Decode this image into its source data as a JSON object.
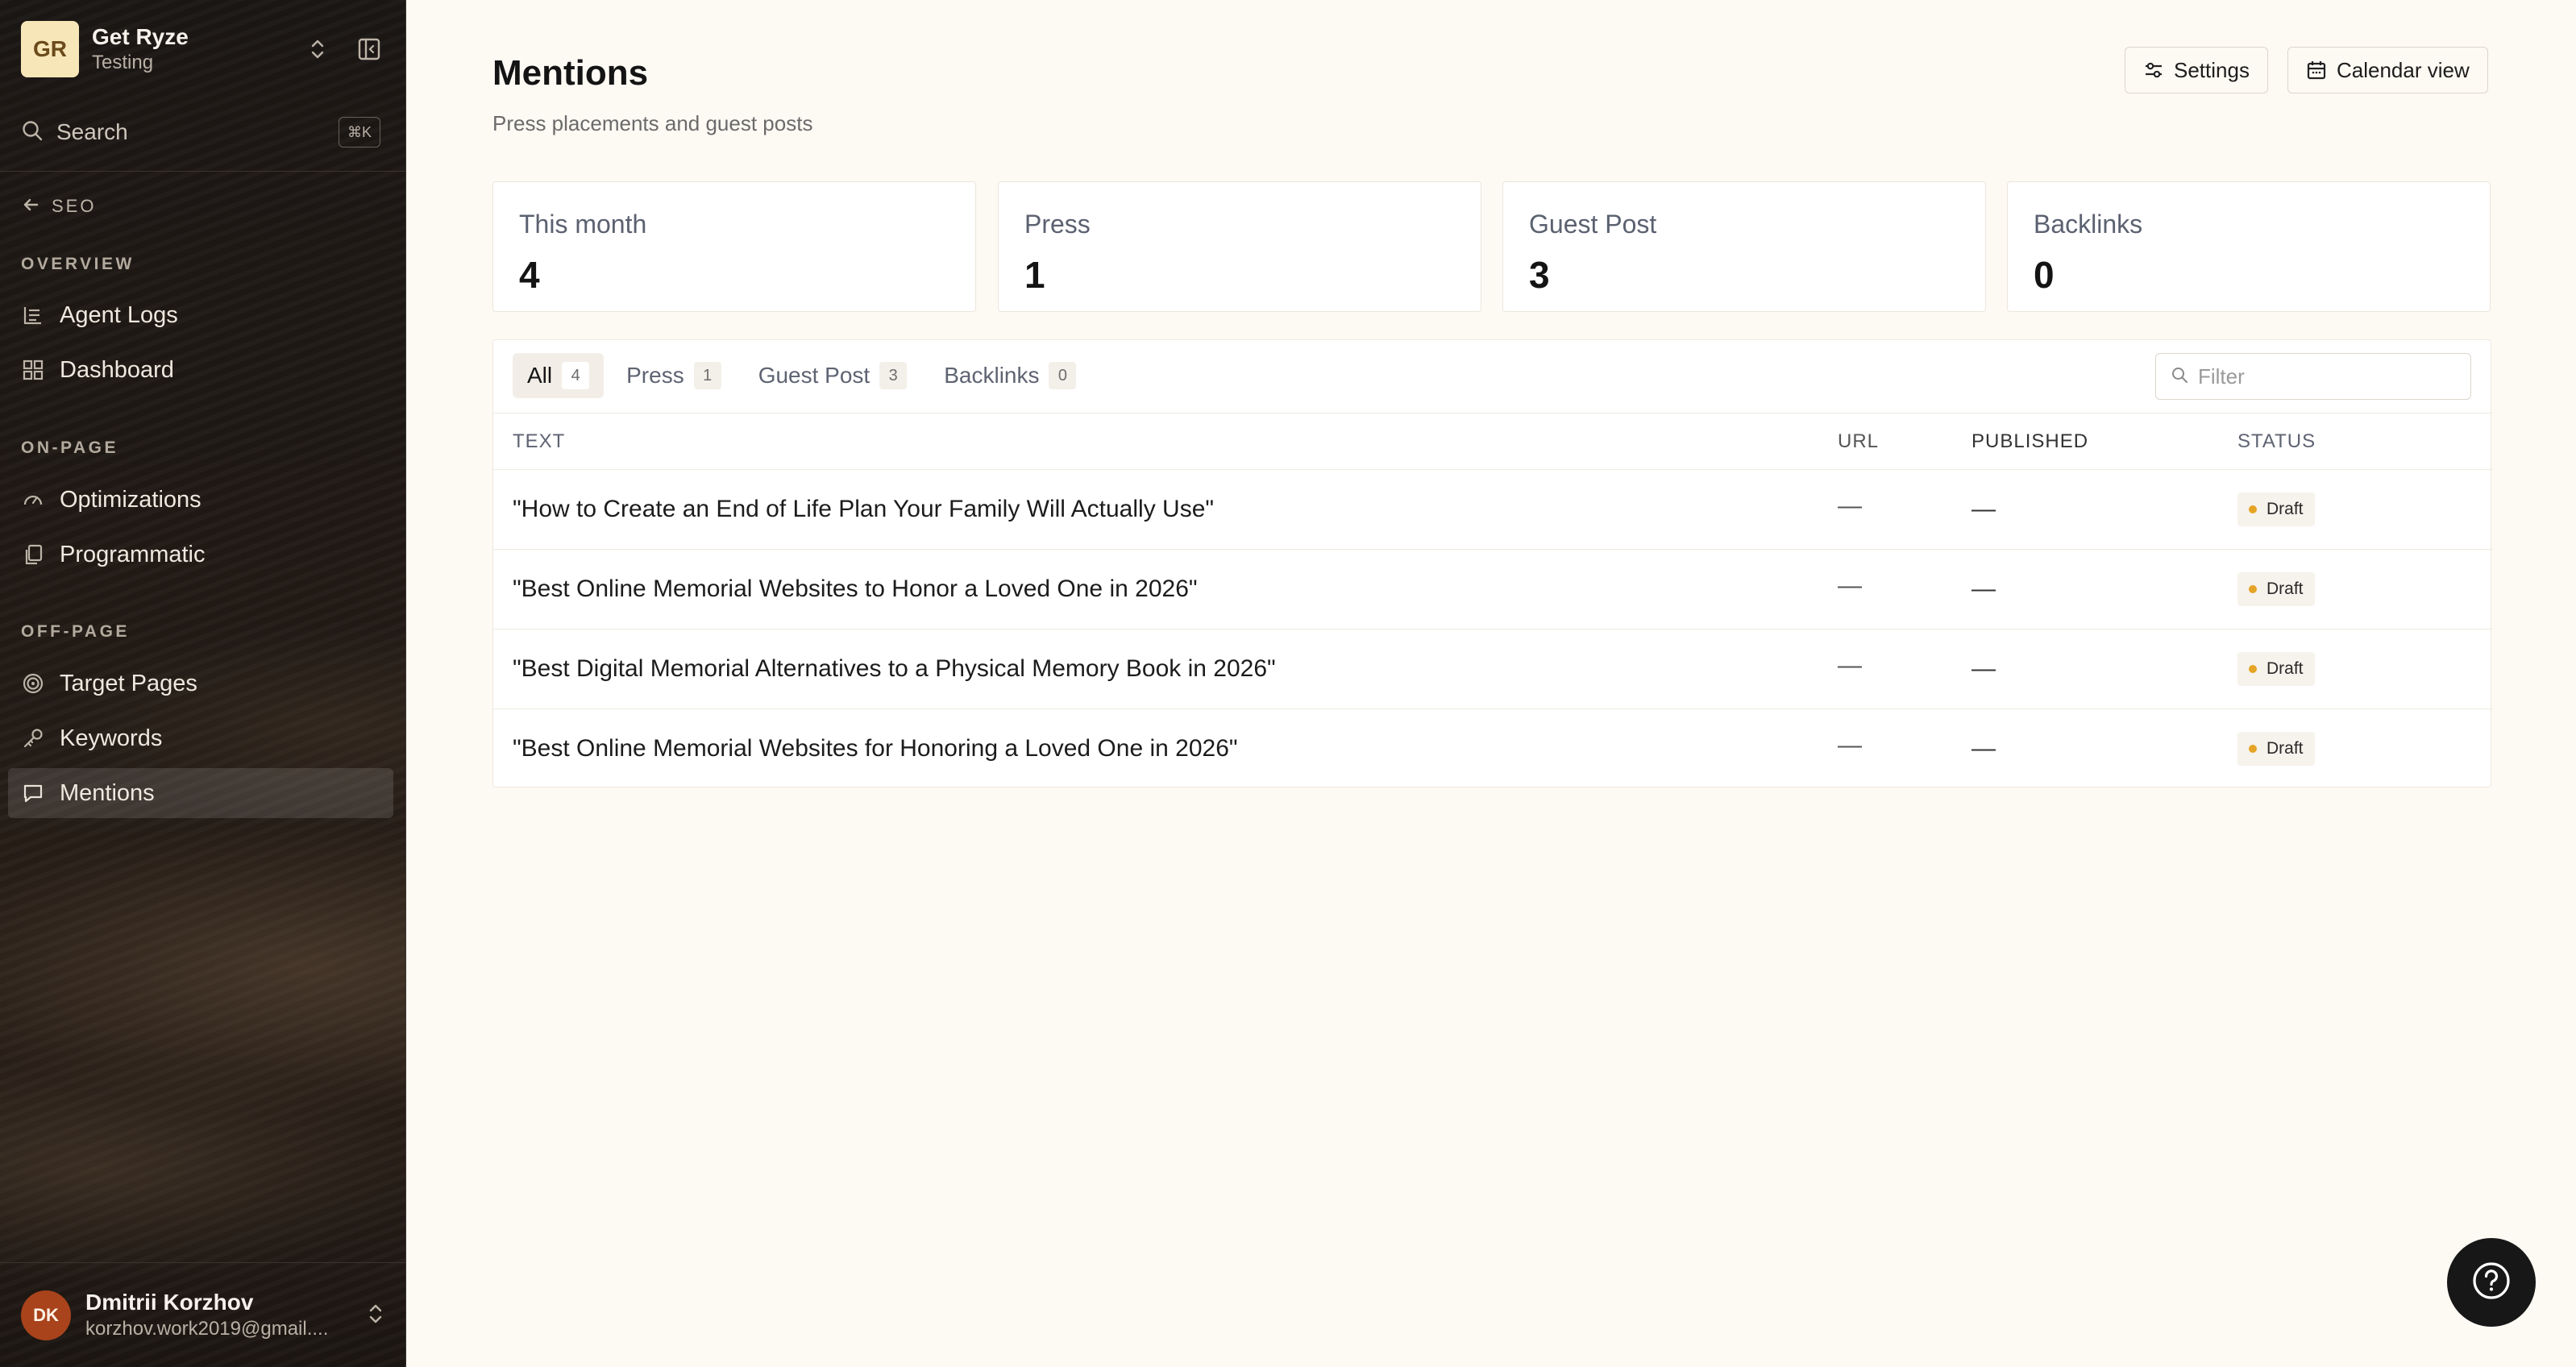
{
  "workspace": {
    "initials": "GR",
    "name": "Get Ryze",
    "subtitle": "Testing"
  },
  "search": {
    "label": "Search",
    "shortcut": "⌘K"
  },
  "nav": {
    "back_label": "SEO",
    "sections": [
      {
        "title": "OVERVIEW",
        "items": [
          {
            "label": "Agent Logs",
            "icon": "list-icon"
          },
          {
            "label": "Dashboard",
            "icon": "grid-icon"
          }
        ]
      },
      {
        "title": "ON-PAGE",
        "items": [
          {
            "label": "Optimizations",
            "icon": "gauge-icon"
          },
          {
            "label": "Programmatic",
            "icon": "copy-icon"
          }
        ]
      },
      {
        "title": "OFF-PAGE",
        "items": [
          {
            "label": "Target Pages",
            "icon": "target-icon"
          },
          {
            "label": "Keywords",
            "icon": "key-icon"
          },
          {
            "label": "Mentions",
            "icon": "message-icon",
            "active": true
          }
        ]
      }
    ]
  },
  "user": {
    "initials": "DK",
    "name": "Dmitrii Korzhov",
    "email": "korzhov.work2019@gmail...."
  },
  "header": {
    "title": "Mentions",
    "subtitle": "Press placements and guest posts",
    "settings_label": "Settings",
    "calendar_label": "Calendar view"
  },
  "stats": [
    {
      "label": "This month",
      "value": "4"
    },
    {
      "label": "Press",
      "value": "1"
    },
    {
      "label": "Guest Post",
      "value": "3"
    },
    {
      "label": "Backlinks",
      "value": "0"
    }
  ],
  "tabs": [
    {
      "label": "All",
      "count": "4",
      "active": true
    },
    {
      "label": "Press",
      "count": "1"
    },
    {
      "label": "Guest Post",
      "count": "3"
    },
    {
      "label": "Backlinks",
      "count": "0"
    }
  ],
  "filter": {
    "placeholder": "Filter"
  },
  "table": {
    "columns": [
      "TEXT",
      "URL",
      "PUBLISHED",
      "STATUS"
    ],
    "rows": [
      {
        "text": "\"How to Create an End of Life Plan Your Family Will Actually Use\"",
        "url": "—",
        "published": "—",
        "status": "Draft"
      },
      {
        "text": "\"Best Online Memorial Websites to Honor a Loved One in 2026\"",
        "url": "—",
        "published": "—",
        "status": "Draft"
      },
      {
        "text": "\"Best Digital Memorial Alternatives to a Physical Memory Book in 2026\"",
        "url": "—",
        "published": "—",
        "status": "Draft"
      },
      {
        "text": "\"Best Online Memorial Websites for Honoring a Loved One in 2026\"",
        "url": "—",
        "published": "—",
        "status": "Draft"
      }
    ]
  },
  "colors": {
    "status_draft": "#e5a425",
    "workspace_logo_bg": "#f7e6b8",
    "avatar_bg": "#a8431c"
  }
}
